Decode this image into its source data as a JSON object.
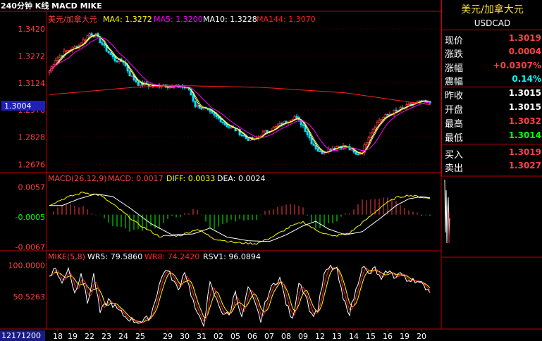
{
  "header": {
    "title": "240分钟 K线 MACD MIKE",
    "main_indicator": {
      "name": "美元/加拿大元",
      "ma4": "MA4: 1.3272",
      "ma5": "MA5: 1.3200",
      "ma10": "MA10: 1.3228",
      "ma144": "MA144: 1.3070"
    },
    "macd_indicator": {
      "name": "MACD(26,12,9)",
      "macd": "MACD: 0.0017",
      "diff": "DIFF: 0.0033",
      "dea": "DEA: 0.0024"
    },
    "mike_indicator": {
      "name": "MIKE(5,8)",
      "wr5": "WR5: 79.5860",
      "wr8": "WR8: 74.2420",
      "rsv1": "RSV1: 96.0894"
    }
  },
  "colors": {
    "up": "#ff3b3b",
    "down": "#00e4ff",
    "ma4": "#ffffff",
    "ma5": "#ffff00",
    "ma10": "#ff00ff",
    "ma144": "#ff2020",
    "frame": "#c00000",
    "axis_text": "#ff4040"
  },
  "quote_panel": {
    "title": "美元/加拿大元",
    "symbol": "USDCAD",
    "rows": [
      {
        "label": "现价",
        "value": "1.3019",
        "color": "#ff4040"
      },
      {
        "label": "涨跌",
        "value": "0.0004",
        "color": "#ff4040"
      },
      {
        "label": "涨幅",
        "value": "+0.0307%",
        "color": "#ff4040"
      },
      {
        "label": "震幅",
        "value": "0.14%",
        "color": "#00ffff"
      },
      {
        "label": "昨收",
        "value": "1.3015",
        "color": "#ffffff"
      },
      {
        "label": "开盘",
        "value": "1.3015",
        "color": "#ffffff"
      },
      {
        "label": "最高",
        "value": "1.3032",
        "color": "#ff4040"
      },
      {
        "label": "最低",
        "value": "1.3014",
        "color": "#00ff00"
      },
      {
        "label": "买入",
        "value": "1.3019",
        "color": "#ff4040"
      },
      {
        "label": "卖出",
        "value": "1.3027",
        "color": "#ff4040"
      }
    ]
  },
  "chart_data": {
    "type": "candlestick",
    "current_price_label": "1.3004",
    "date_label": "12171200",
    "x_tick_labels": [
      "18",
      "19",
      "22",
      "23",
      "24",
      "25",
      "29",
      "30",
      "31",
      "02",
      "05",
      "06",
      "07",
      "08",
      "09",
      "12",
      "13",
      "14",
      "15",
      "16",
      "19",
      "20"
    ],
    "x_tick_candle_index": [
      4,
      11,
      19,
      27,
      35,
      43,
      56,
      64,
      72,
      80,
      88,
      96,
      104,
      112,
      120,
      128,
      136,
      144,
      152,
      160,
      168,
      176
    ],
    "price_axis": {
      "ylim": [
        1.264,
        1.344
      ],
      "ticks": [
        "1.3420",
        "1.3272",
        "1.3124",
        "1.2976",
        "1.2828",
        "1.2676"
      ],
      "tick_values": [
        1.342,
        1.3272,
        1.3124,
        1.2976,
        1.2828,
        1.2676
      ]
    },
    "macd_axis": {
      "ylim": [
        -0.0072,
        0.0062
      ],
      "ticks": [
        "0.0057",
        "-0.0005",
        "-0.0067"
      ],
      "tick_values": [
        0.0057,
        -0.0005,
        -0.0067
      ]
    },
    "mike_axis": {
      "ylim": [
        0,
        105
      ],
      "ticks": [
        "100.0000",
        "50.5263"
      ],
      "tick_values": [
        100,
        50.5263
      ]
    },
    "price_keypoints": [
      [
        0,
        1.319
      ],
      [
        3,
        1.3255
      ],
      [
        8,
        1.33
      ],
      [
        14,
        1.333
      ],
      [
        19,
        1.3395
      ],
      [
        22,
        1.3385
      ],
      [
        26,
        1.332
      ],
      [
        31,
        1.325
      ],
      [
        35,
        1.324
      ],
      [
        38,
        1.317
      ],
      [
        42,
        1.312
      ],
      [
        46,
        1.3115
      ],
      [
        50,
        1.3105
      ],
      [
        54,
        1.3115
      ],
      [
        58,
        1.31
      ],
      [
        62,
        1.3105
      ],
      [
        66,
        1.309
      ],
      [
        69,
        1.3
      ],
      [
        73,
        1.2985
      ],
      [
        77,
        1.295
      ],
      [
        81,
        1.292
      ],
      [
        84,
        1.289
      ],
      [
        89,
        1.286
      ],
      [
        93,
        1.282
      ],
      [
        97,
        1.281
      ],
      [
        101,
        1.285
      ],
      [
        105,
        1.287
      ],
      [
        110,
        1.29
      ],
      [
        116,
        1.294
      ],
      [
        120,
        1.289
      ],
      [
        124,
        1.28
      ],
      [
        128,
        1.274
      ],
      [
        132,
        1.276
      ],
      [
        137,
        1.278
      ],
      [
        141,
        1.277
      ],
      [
        145,
        1.273
      ],
      [
        148,
        1.275
      ],
      [
        152,
        1.286
      ],
      [
        156,
        1.292
      ],
      [
        160,
        1.295
      ],
      [
        164,
        1.297
      ],
      [
        168,
        1.299
      ],
      [
        172,
        1.301
      ],
      [
        176,
        1.302
      ],
      [
        180,
        1.3015
      ]
    ],
    "ma144_keypoints": [
      [
        0,
        1.306
      ],
      [
        40,
        1.31
      ],
      [
        60,
        1.311
      ],
      [
        100,
        1.31
      ],
      [
        140,
        1.307
      ],
      [
        170,
        1.302
      ],
      [
        180,
        1.3005
      ]
    ],
    "macd_keypoints": [
      [
        0,
        0.002
      ],
      [
        8,
        0.0035
      ],
      [
        16,
        0.0046
      ],
      [
        24,
        0.004
      ],
      [
        32,
        0.0015
      ],
      [
        42,
        -0.002
      ],
      [
        52,
        -0.0045
      ],
      [
        62,
        -0.0043
      ],
      [
        70,
        -0.003
      ],
      [
        78,
        -0.005
      ],
      [
        88,
        -0.0058
      ],
      [
        98,
        -0.006
      ],
      [
        106,
        -0.0045
      ],
      [
        114,
        -0.0025
      ],
      [
        120,
        -0.0015
      ],
      [
        126,
        -0.0032
      ],
      [
        134,
        -0.0045
      ],
      [
        142,
        -0.0038
      ],
      [
        150,
        -0.001
      ],
      [
        158,
        0.002
      ],
      [
        164,
        0.0035
      ],
      [
        170,
        0.004
      ],
      [
        176,
        0.0036
      ],
      [
        180,
        0.0033
      ]
    ],
    "mike_wr_keypoints": [
      [
        0,
        85
      ],
      [
        3,
        95
      ],
      [
        6,
        70
      ],
      [
        9,
        98
      ],
      [
        12,
        55
      ],
      [
        15,
        90
      ],
      [
        18,
        40
      ],
      [
        21,
        85
      ],
      [
        24,
        25
      ],
      [
        28,
        45
      ],
      [
        32,
        30
      ],
      [
        36,
        18
      ],
      [
        40,
        12
      ],
      [
        44,
        10
      ],
      [
        48,
        20
      ],
      [
        52,
        70
      ],
      [
        55,
        95
      ],
      [
        58,
        80
      ],
      [
        61,
        60
      ],
      [
        64,
        92
      ],
      [
        67,
        55
      ],
      [
        70,
        20
      ],
      [
        73,
        8
      ],
      [
        76,
        70
      ],
      [
        79,
        45
      ],
      [
        82,
        25
      ],
      [
        85,
        20
      ],
      [
        88,
        60
      ],
      [
        91,
        15
      ],
      [
        94,
        65
      ],
      [
        97,
        40
      ],
      [
        100,
        12
      ],
      [
        103,
        50
      ],
      [
        106,
        70
      ],
      [
        109,
        80
      ],
      [
        112,
        40
      ],
      [
        115,
        12
      ],
      [
        118,
        75
      ],
      [
        121,
        55
      ],
      [
        124,
        20
      ],
      [
        127,
        30
      ],
      [
        130,
        85
      ],
      [
        133,
        98
      ],
      [
        136,
        92
      ],
      [
        139,
        45
      ],
      [
        142,
        25
      ],
      [
        145,
        60
      ],
      [
        148,
        100
      ],
      [
        151,
        85
      ],
      [
        154,
        95
      ],
      [
        157,
        75
      ],
      [
        160,
        92
      ],
      [
        163,
        82
      ],
      [
        166,
        88
      ],
      [
        169,
        75
      ],
      [
        172,
        80
      ],
      [
        175,
        70
      ],
      [
        178,
        65
      ],
      [
        180,
        60
      ]
    ]
  }
}
